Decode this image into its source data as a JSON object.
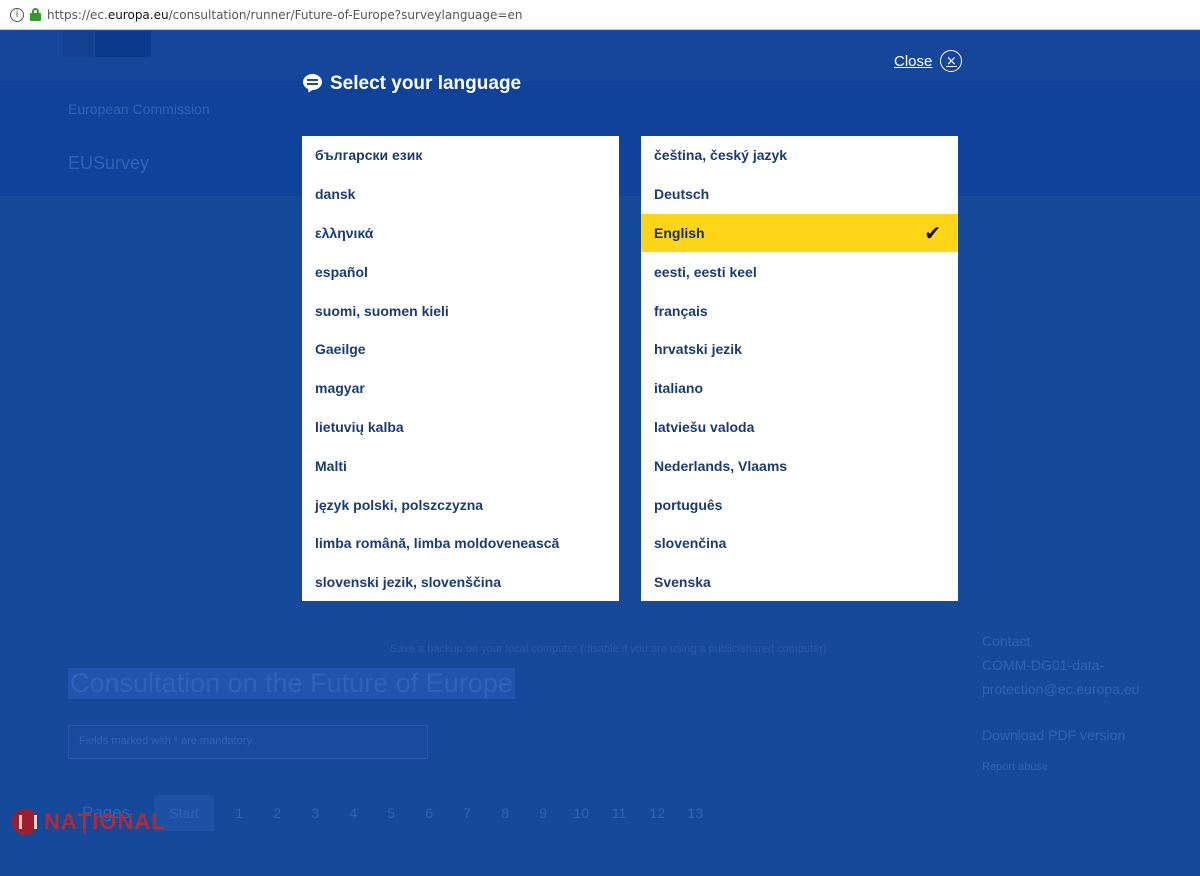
{
  "browser": {
    "url_prefix": "https://ec.",
    "url_domain": "europa.eu",
    "url_path": "/consultation/runner/Future-of-Europe?surveylanguage=en",
    "info_icon": "info-icon",
    "lock_icon": "lock-icon"
  },
  "background": {
    "breadcrumb": "European Commission",
    "site_name": "EUSurvey",
    "survey_title": "Consultation on the Future of Europe",
    "search_placeholder": "Fields marked with * are mandatory.",
    "pages_label": "Pages",
    "first_page": "Start",
    "pages": [
      "1",
      "2",
      "3",
      "4",
      "5",
      "6",
      "7",
      "8",
      "9",
      "10",
      "11",
      "12",
      "13"
    ],
    "checkbox_text": "Save a backup on your local computer (disable if you are using a public/shared computer)",
    "contact_label": "Contact",
    "contact_line1": "COMM-DG01-data-",
    "contact_line2": "protection@ec.europa.eu",
    "download_pdf": "Download PDF version",
    "report_abuse": "Report abuse"
  },
  "watermark": {
    "text": "NAȚIONAL"
  },
  "modal": {
    "close_label": "Close",
    "close_icon": "×",
    "title": "Select your language",
    "left_languages": [
      "български език",
      "dansk",
      "ελληνικά",
      "español",
      "suomi, suomen kieli",
      "Gaeilge",
      "magyar",
      "lietuvių kalba",
      "Malti",
      "język polski, polszczyzna",
      "limba română, limba moldovenească",
      "slovenski jezik, slovenščina"
    ],
    "right_languages": [
      "čeština, český jazyk",
      "Deutsch",
      "English",
      "eesti, eesti keel",
      "français",
      "hrvatski jezik",
      "italiano",
      "latviešu valoda",
      "Nederlands, Vlaams",
      "português",
      "slovenčina",
      "Svenska"
    ],
    "selected_language": "English",
    "check_glyph": "✔",
    "colors": {
      "selected_bg": "#ffd617",
      "text": "#1a3b73",
      "overlay": "#1a4a9e"
    }
  }
}
